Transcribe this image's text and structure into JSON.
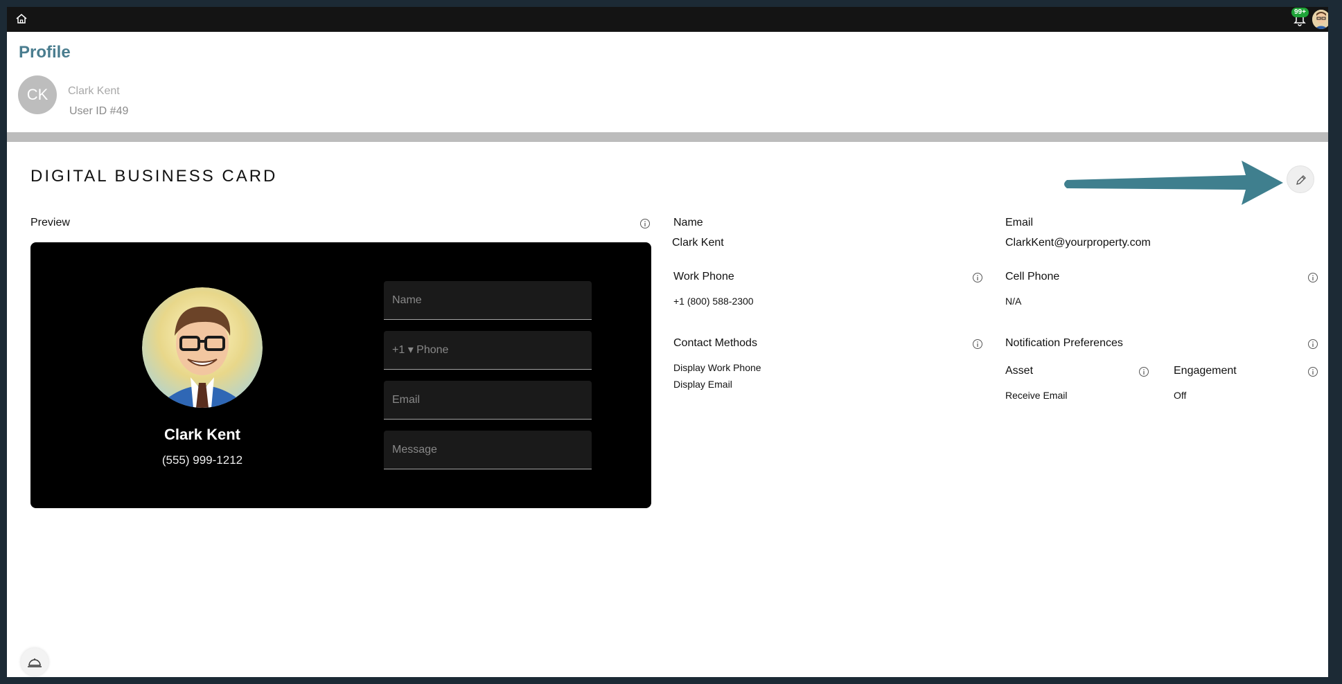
{
  "topbar": {
    "notification_count": "99+"
  },
  "profile": {
    "title": "Profile",
    "initials": "CK",
    "name": "Clark Kent",
    "user_id": "User ID #49"
  },
  "section": {
    "title": "DIGITAL BUSINESS CARD"
  },
  "preview": {
    "label": "Preview",
    "card_name": "Clark Kent",
    "card_phone": "(555) 999-1212",
    "fields": {
      "name_placeholder": "Name",
      "phone_placeholder": "+1 ▾ Phone",
      "email_placeholder": "Email",
      "message_placeholder": "Message"
    }
  },
  "details": {
    "name_label": "Name",
    "name_value": "Clark Kent",
    "email_label": "Email",
    "email_value": "ClarkKent@yourproperty.com",
    "work_phone_label": "Work Phone",
    "work_phone_value": "+1 (800) 588-2300",
    "cell_phone_label": "Cell Phone",
    "cell_phone_value": "N/A",
    "contact_methods_label": "Contact Methods",
    "contact_methods": [
      "Display Work Phone",
      "Display Email"
    ],
    "notification_prefs_label": "Notification Preferences",
    "asset_label": "Asset",
    "asset_value": "Receive Email",
    "engagement_label": "Engagement",
    "engagement_value": "Off"
  },
  "colors": {
    "accent": "#4a7d8f",
    "arrow": "#3f7f8e",
    "topbar": "#141414",
    "card_bg": "#000000",
    "badge": "#1fa338"
  },
  "icons": [
    "home-icon",
    "bell-icon",
    "info-icon",
    "pencil-icon",
    "concierge-bell-icon"
  ]
}
